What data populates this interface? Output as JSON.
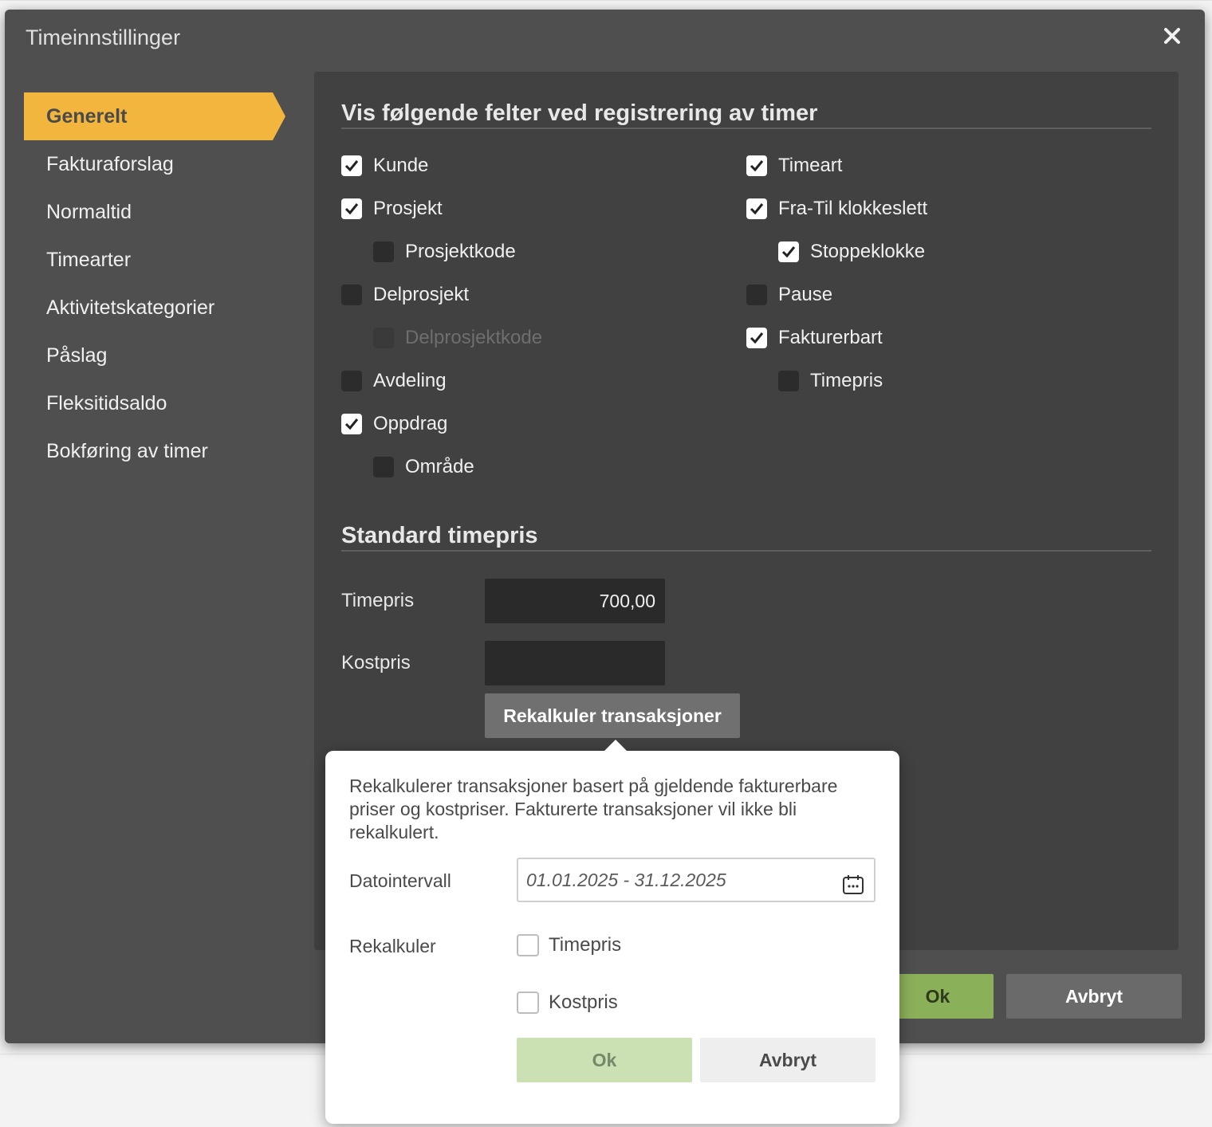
{
  "dialog": {
    "title": "Timeinnstillinger"
  },
  "sidebar": {
    "items": [
      {
        "label": "Generelt",
        "active": true
      },
      {
        "label": "Fakturaforslag"
      },
      {
        "label": "Normaltid"
      },
      {
        "label": "Timearter"
      },
      {
        "label": "Aktivitetskategorier"
      },
      {
        "label": "Påslag"
      },
      {
        "label": "Fleksitidsaldo"
      },
      {
        "label": "Bokføring av timer"
      }
    ]
  },
  "fields_section": {
    "title": "Vis følgende felter ved registrering av timer",
    "left": [
      {
        "label": "Kunde",
        "checked": true
      },
      {
        "label": "Prosjekt",
        "checked": true
      },
      {
        "label": "Prosjektkode",
        "checked": false
      },
      {
        "label": "Delprosjekt",
        "checked": false
      },
      {
        "label": "Delprosjektkode",
        "checked": false,
        "disabled": true
      },
      {
        "label": "Avdeling",
        "checked": false
      },
      {
        "label": "Oppdrag",
        "checked": true
      },
      {
        "label": "Område",
        "checked": false
      }
    ],
    "right": [
      {
        "label": "Timeart",
        "checked": true
      },
      {
        "label": "Fra-Til klokkeslett",
        "checked": true
      },
      {
        "label": "Stoppeklokke",
        "checked": true
      },
      {
        "label": "Pause",
        "checked": false
      },
      {
        "label": "Fakturerbart",
        "checked": true
      },
      {
        "label": "Timepris",
        "checked": false
      }
    ]
  },
  "price_section": {
    "title": "Standard timepris",
    "timepris_label": "Timepris",
    "timepris_value": "700,00",
    "kostpris_label": "Kostpris",
    "kostpris_value": "",
    "recalc_button": "Rekalkuler transaksjoner"
  },
  "footer": {
    "ok_label": "Ok",
    "cancel_label": "Avbryt"
  },
  "popover": {
    "description": "Rekalkulerer transaksjoner basert på gjeldende fakturerbare priser og kostpriser. Fakturerte transaksjoner vil ikke bli rekalkulert.",
    "date_label": "Datointervall",
    "date_value": "01.01.2025 - 31.12.2025",
    "recalc_label": "Rekalkuler",
    "options": [
      {
        "label": "Timepris",
        "checked": false
      },
      {
        "label": "Kostpris",
        "checked": false
      }
    ],
    "ok_label": "Ok",
    "cancel_label": "Avbryt"
  }
}
